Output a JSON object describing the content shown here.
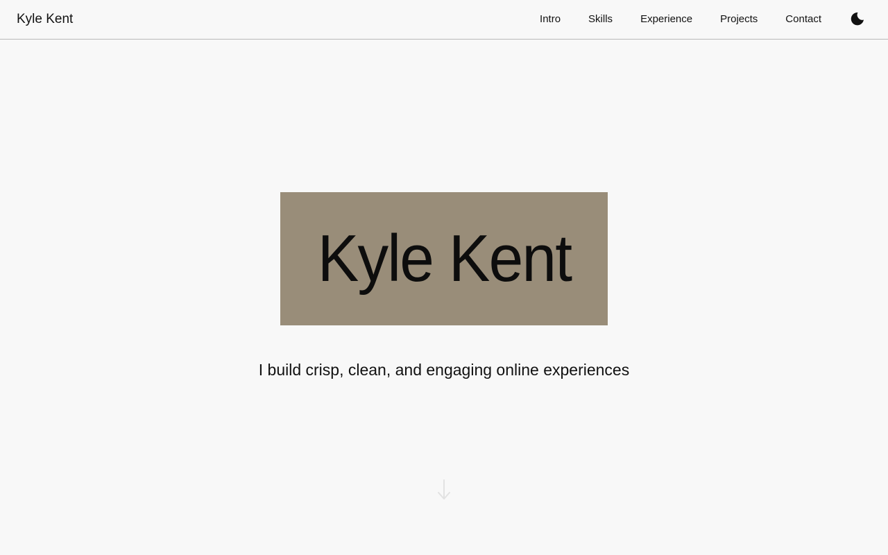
{
  "header": {
    "brand": "Kyle Kent",
    "nav": [
      {
        "label": "Intro"
      },
      {
        "label": "Skills"
      },
      {
        "label": "Experience"
      },
      {
        "label": "Projects"
      },
      {
        "label": "Contact"
      }
    ],
    "theme_toggle_icon": "moon-icon"
  },
  "hero": {
    "name": "Kyle Kent",
    "tagline": "I build crisp, clean, and engaging online experiences",
    "box_color": "#998d79",
    "scroll_icon": "arrow-down-icon"
  },
  "colors": {
    "background": "#f8f8f8",
    "text": "#111111",
    "accent_box": "#998d79"
  }
}
